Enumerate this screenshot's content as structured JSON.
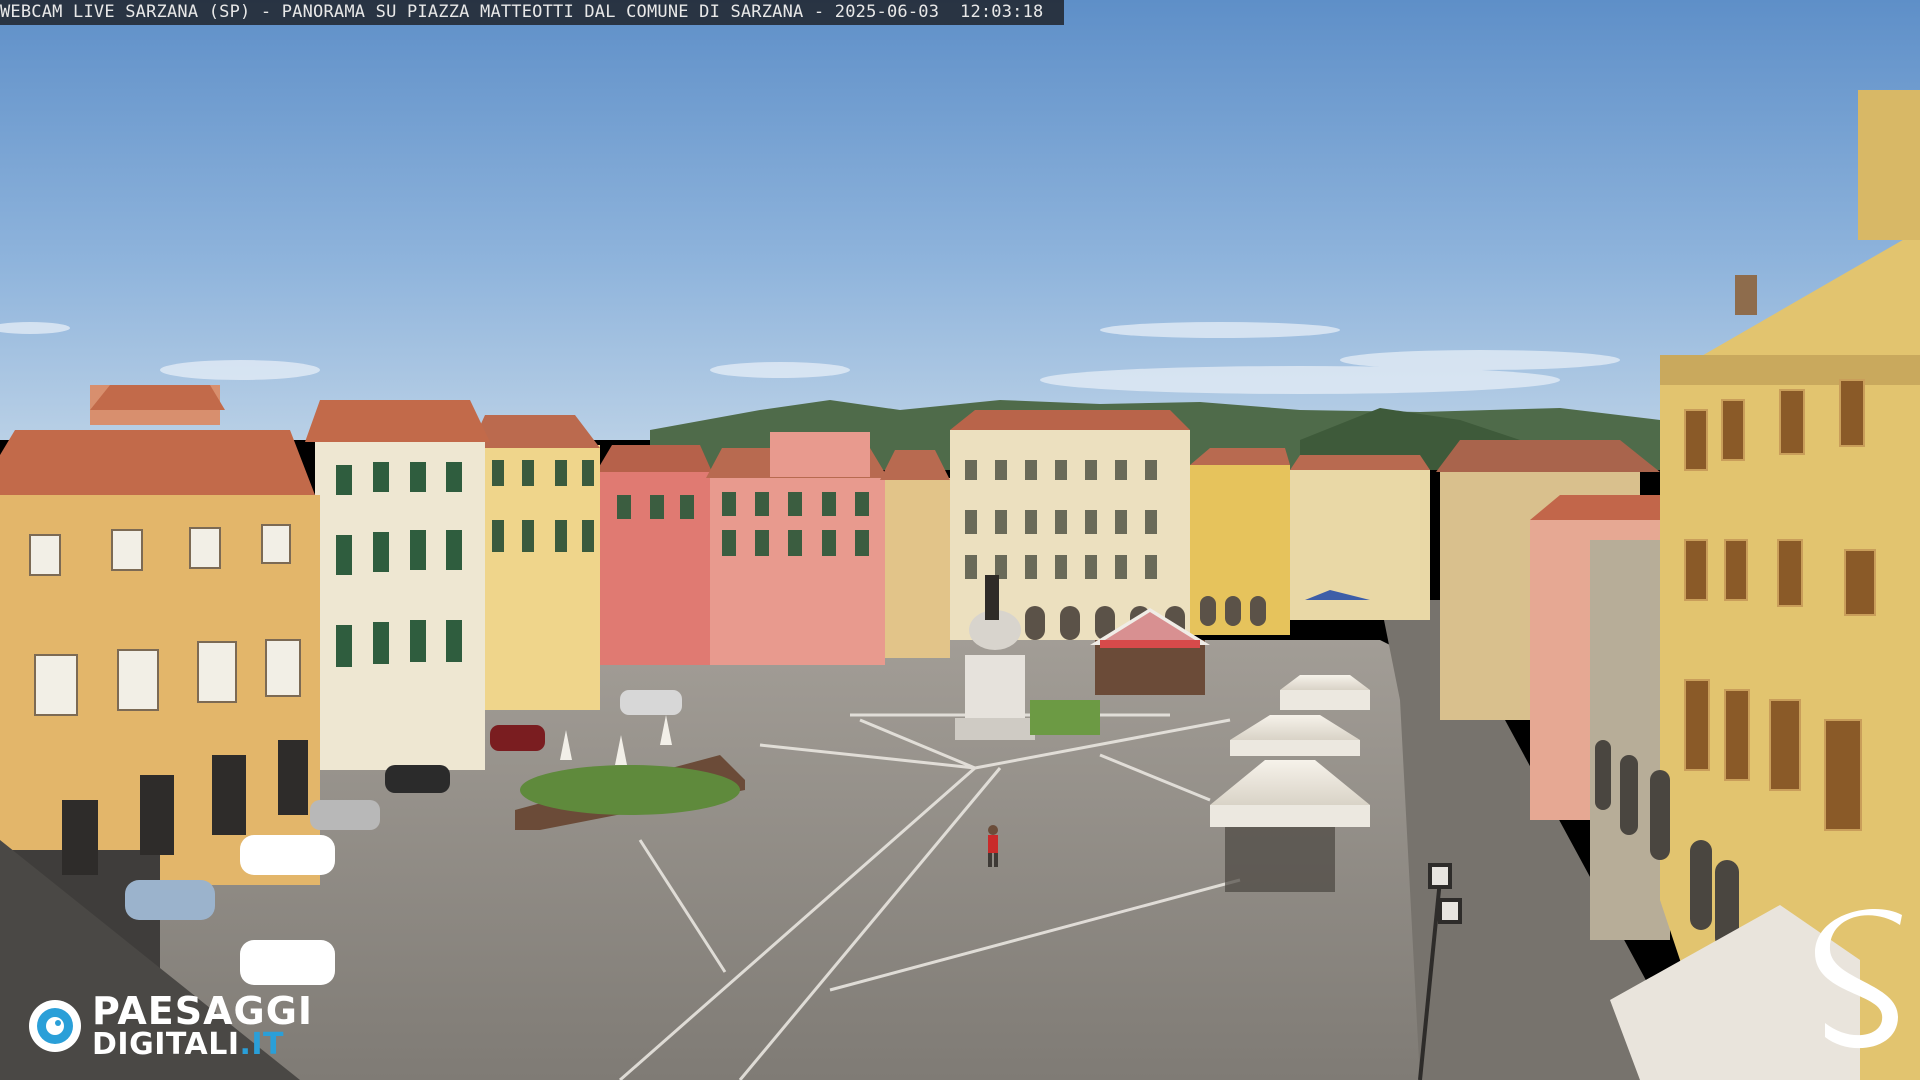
{
  "overlay": {
    "caption": "WEBCAM LIVE SARZANA (SP) - PANORAMA SU PIAZZA MATTEOTTI DAL COMUNE DI SARZANA - 2025-06-03  12:03:18"
  },
  "logos": {
    "paesaggi_line1": "PAESAGGI",
    "paesaggi_line2": "DIGITALI",
    "paesaggi_tld": ".IT",
    "corner_mark": "S"
  },
  "colors": {
    "sky_top": "#5e8fc8",
    "sky_bottom": "#a9c6e3",
    "pavement": "#8f8b85",
    "roof_tile": "#c26a4a",
    "ochre_facade": "#e3b66a",
    "pink_facade": "#e07a72",
    "salmon_facade": "#e89a8e",
    "cream_facade": "#ece0bf",
    "logo_accent": "#2a9fd8"
  }
}
